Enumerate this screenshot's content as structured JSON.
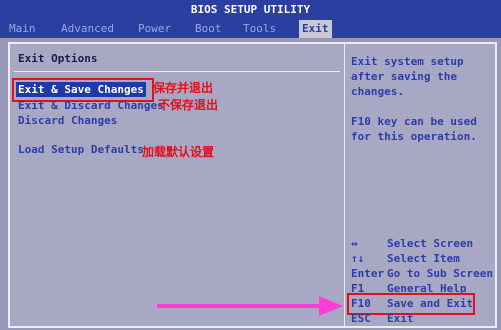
{
  "title": "BIOS SETUP UTILITY",
  "menu": [
    {
      "label": "Main"
    },
    {
      "label": "Advanced"
    },
    {
      "label": "Power"
    },
    {
      "label": "Boot"
    },
    {
      "label": "Tools"
    },
    {
      "label": "Exit"
    }
  ],
  "exit_panel": {
    "heading": "Exit Options",
    "options": [
      {
        "label": "Exit & Save Changes"
      },
      {
        "label": "Exit & Discard Changes"
      },
      {
        "label": "Discard Changes"
      },
      {
        "label": "Load Setup Defaults"
      }
    ],
    "annotations": {
      "save_exit": "保存并退出",
      "discard_exit": "不保存退出",
      "load_defaults": "加载默认设置"
    }
  },
  "help": {
    "lines": [
      "Exit system setup",
      "after saving the",
      "changes.",
      "",
      "F10 key can be used",
      "for this operation."
    ]
  },
  "keys": [
    {
      "key": "↔",
      "desc": "Select Screen"
    },
    {
      "key": "↑↓",
      "desc": "Select Item"
    },
    {
      "key": "Enter",
      "desc": "Go to Sub Screen"
    },
    {
      "key": "F1",
      "desc": "General Help"
    },
    {
      "key": "F10",
      "desc": "Save and Exit"
    },
    {
      "key": "ESC",
      "desc": "Exit"
    }
  ],
  "colors": {
    "bar": "#2a3fa0",
    "annotation": "#e0101c",
    "arrow": "#ff3cd8"
  }
}
